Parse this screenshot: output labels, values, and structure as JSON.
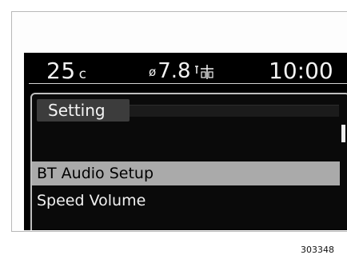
{
  "status": {
    "temperature": "25",
    "temperature_unit": "c",
    "fuel_economy": "7.8",
    "time": "10:00"
  },
  "menu": {
    "title": "Setting",
    "items": [
      {
        "label": "BT Audio Setup",
        "selected": true
      },
      {
        "label": "Speed Volume",
        "selected": false
      }
    ],
    "scroll_position": 0.1
  },
  "reference_number": "303348"
}
